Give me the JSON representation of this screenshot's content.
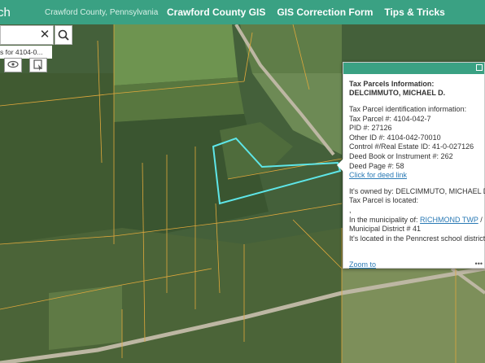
{
  "header": {
    "app_title_fragment": "ch",
    "subtitle": "Crawford County, Pennsylvania",
    "nav": [
      "Crawford County GIS",
      "GIS Correction Form",
      "Tips & Tricks"
    ]
  },
  "search": {
    "clear_glyph": "✕",
    "suggestion": "s for 4104-0..."
  },
  "popup": {
    "title": "Tax Parcels Information: DELCIMMUTO, MICHAEL D.",
    "section_heading": "Tax Parcel identification information:",
    "tax_parcel": "Tax Parcel #: 4104-042-7",
    "pid": "PID #: 27126",
    "other_id": "Other ID #: 4104-042-70010",
    "control": "Control #/Real Estate ID: 41-0-027126",
    "deed_book": "Deed Book or Instrument #: 262",
    "deed_page": "Deed Page #: 58",
    "deed_link": "Click for deed link",
    "owned_by": "It's owned by: DELCIMMUTO, MICHAEL D.",
    "located": "Tax Parcel is located:",
    "comma": ",",
    "municipality_prefix": "In the municipality of: ",
    "municipality_link": "RICHMOND TWP",
    "municipality_suffix": " /",
    "district": "Municipal District # 41",
    "school": "It's located in the Penncrest school district",
    "zoom_to": "Zoom to",
    "more": "•••"
  },
  "icons": {
    "search": "search-icon",
    "clear": "close-icon",
    "tool1": "eye-icon",
    "tool2": "select-icon",
    "maximize": "maximize-icon"
  }
}
